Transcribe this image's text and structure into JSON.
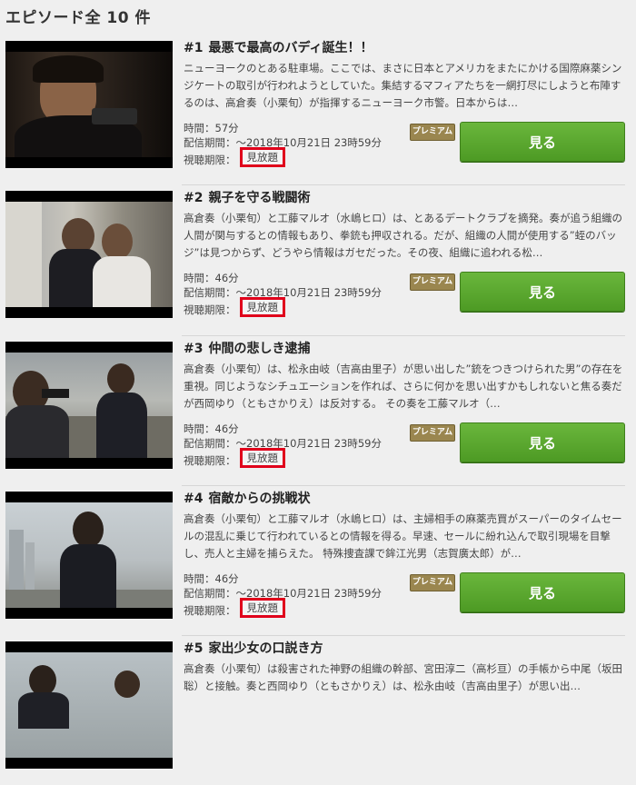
{
  "page_title": "エピソード全 10 件",
  "episodes": [
    {
      "number": "#1",
      "title": "最悪で最高のバディ誕生！！",
      "description": "ニューヨークのとある駐車場。ここでは、まさに日本とアメリカをまたにかける国際麻薬シンジケートの取引が行われようとしていた。集結するマフィアたちを一網打尽にしようと布陣するのは、高倉奏（小栗旬）が指揮するニューヨーク市警。日本からは…",
      "duration": "時間：57分",
      "period": "配信期間：～2018年10月21日 23時59分",
      "limit_label": "視聴期限：",
      "limit_value": "見放題",
      "premium_badge": "プレミアム",
      "button": "見る"
    },
    {
      "number": "#2",
      "title": "親子を守る戦闘術",
      "description": "高倉奏（小栗旬）と工藤マルオ（水嶋ヒロ）は、とあるデートクラブを摘発。奏が追う組織の人間が関与するとの情報もあり、拳銃も押収される。だが、組織の人間が使用する”蛭のバッジ”は見つからず、どうやら情報はガセだった。その夜、組織に追われる松…",
      "duration": "時間：46分",
      "period": "配信期間：～2018年10月21日 23時59分",
      "limit_label": "視聴期限：",
      "limit_value": "見放題",
      "premium_badge": "プレミアム",
      "button": "見る"
    },
    {
      "number": "#3",
      "title": "仲間の悲しき逮捕",
      "description": "高倉奏（小栗旬）は、松永由岐（吉高由里子）が思い出した”銃をつきつけられた男”の存在を重視。同じようなシチュエーションを作れば、さらに何かを思い出すかもしれないと焦る奏だが西岡ゆり（ともさかりえ）は反対する。 その奏を工藤マルオ（…",
      "duration": "時間：46分",
      "period": "配信期間：～2018年10月21日 23時59分",
      "limit_label": "視聴期限：",
      "limit_value": "見放題",
      "premium_badge": "プレミアム",
      "button": "見る"
    },
    {
      "number": "#4",
      "title": "宿敵からの挑戦状",
      "description": "高倉奏（小栗旬）と工藤マルオ（水嶋ヒロ）は、主婦相手の麻薬売買がスーパーのタイムセールの混乱に乗じて行われているとの情報を得る。早速、セールに紛れ込んで取引現場を目撃し、売人と主婦を捕らえた。 特殊捜査課で鉾江光男（志賀廣太郎）が…",
      "duration": "時間：46分",
      "period": "配信期間：～2018年10月21日 23時59分",
      "limit_label": "視聴期限：",
      "limit_value": "見放題",
      "premium_badge": "プレミアム",
      "button": "見る"
    },
    {
      "number": "#5",
      "title": "家出少女の口説き方",
      "description": "高倉奏（小栗旬）は殺害された神野の組織の幹部、宮田淳二（高杉亘）の手帳から中尾（坂田聡）と接触。奏と西岡ゆり（ともさかりえ）は、松永由岐（吉高由里子）が思い出…",
      "duration": "",
      "period": "",
      "limit_label": "",
      "limit_value": "",
      "premium_badge": "",
      "button": ""
    }
  ]
}
